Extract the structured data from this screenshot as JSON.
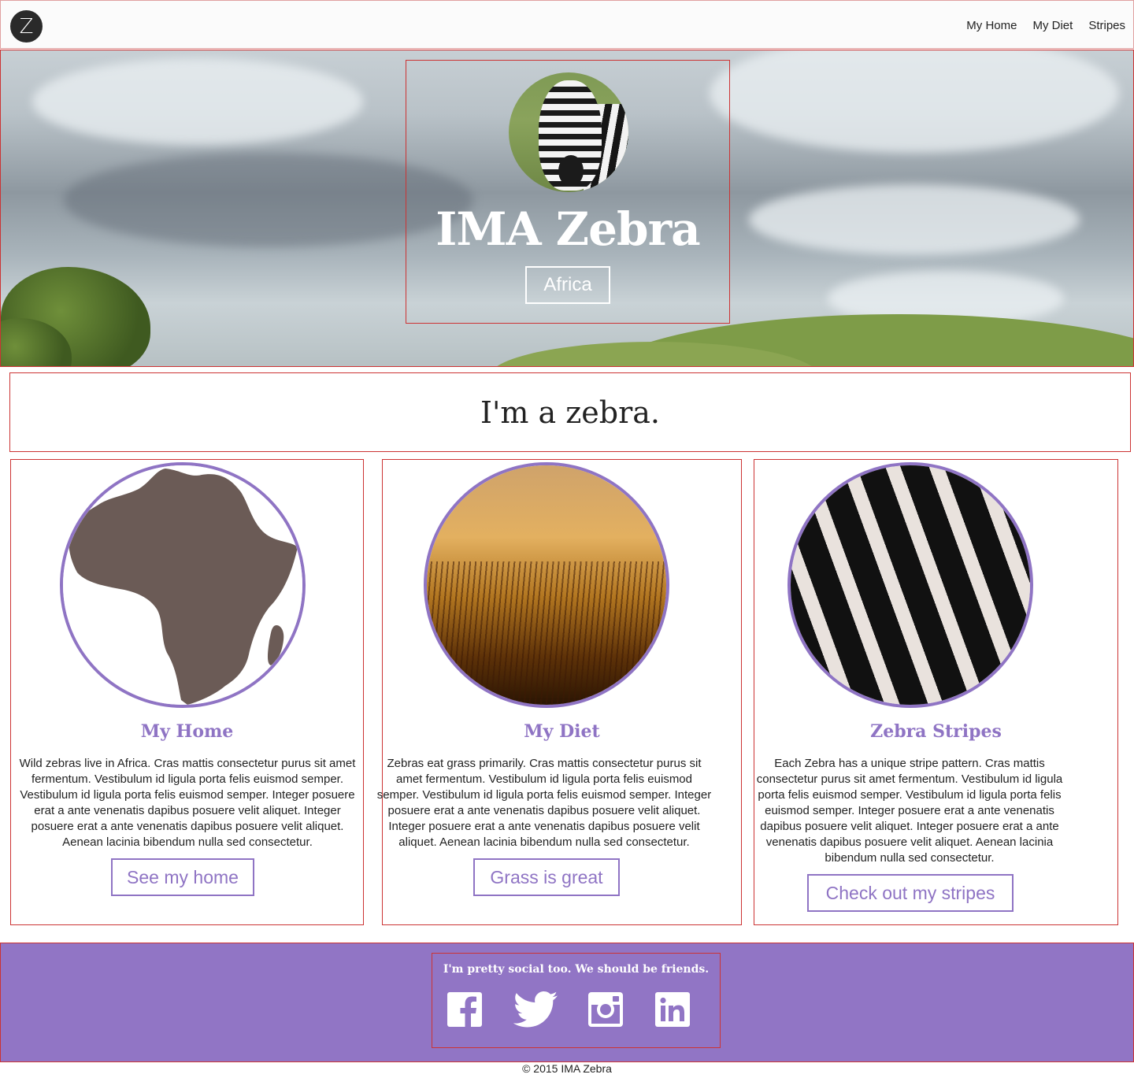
{
  "nav": {
    "logo_letter": "Z",
    "links": [
      "My Home",
      "My Diet",
      "Stripes"
    ]
  },
  "hero": {
    "title": "IMA Zebra",
    "button": "Africa"
  },
  "intro": {
    "heading": "I'm a zebra."
  },
  "cards": [
    {
      "title": "My Home",
      "text": "Wild zebras live in Africa. Cras mattis consectetur purus sit amet fermentum. Vestibulum id ligula porta felis euismod semper. Vestibulum id ligula porta felis euismod semper. Integer posuere erat a ante venenatis dapibus posuere velit aliquet. Integer posuere erat a ante venenatis dapibus posuere velit aliquet. Aenean lacinia bibendum nulla sed consectetur.",
      "button": "See my home",
      "image_icon": "africa-map"
    },
    {
      "title": "My Diet",
      "text": "Zebras eat grass primarily. Cras mattis consectetur purus sit amet fermentum. Vestibulum id ligula porta felis euismod semper. Vestibulum id ligula porta felis euismod semper. Integer posuere erat a ante venenatis dapibus posuere velit aliquet. Integer posuere erat a ante venenatis dapibus posuere velit aliquet. Aenean lacinia bibendum nulla sed consectetur.",
      "button": "Grass is great",
      "image_icon": "grass-photo"
    },
    {
      "title": "Zebra Stripes",
      "text": "Each Zebra has a unique stripe pattern. Cras mattis consectetur purus sit amet fermentum. Vestibulum id ligula porta felis euismod semper. Vestibulum id ligula porta felis euismod semper. Integer posuere erat a ante venenatis dapibus posuere velit aliquet. Integer posuere erat a ante venenatis dapibus posuere velit aliquet. Aenean lacinia bibendum nulla sed consectetur.",
      "button": "Check out my stripes",
      "image_icon": "zebra-stripes-photo"
    }
  ],
  "footer": {
    "tagline": "I'm pretty social too. We should be friends.",
    "socials": [
      "facebook-icon",
      "twitter-icon",
      "instagram-icon",
      "linkedin-icon"
    ],
    "copyright": "© 2015 IMA Zebra"
  },
  "colors": {
    "accent": "#8f74c4",
    "footer_bg": "#9175c5",
    "outline": "#cc3333"
  }
}
